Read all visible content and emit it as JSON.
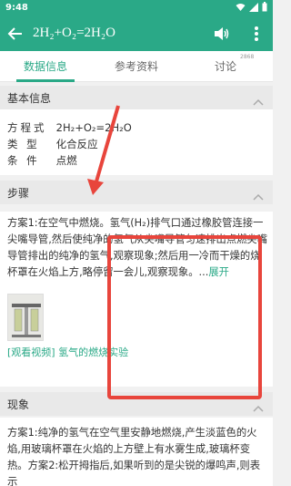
{
  "status_bar": {
    "time": "9:48"
  },
  "header": {
    "title": "2H₂+O₂=2H₂O"
  },
  "tabs": [
    {
      "label": "数据信息"
    },
    {
      "label": "参考资料"
    },
    {
      "label": "讨论",
      "badge": "2868"
    }
  ],
  "basic_info": {
    "heading": "基本信息",
    "rows": [
      {
        "label": "方程式",
        "value": "2H₂+O₂=2H₂O"
      },
      {
        "label": "类 型",
        "value": "化合反应"
      },
      {
        "label": "条 件",
        "value": "点燃"
      }
    ]
  },
  "steps": {
    "heading": "步骤",
    "text": "方案1:在空气中燃烧。氢气(H₂)排气口通过橡胶管连接一尖嘴导管,然后使纯净的氢气从尖嘴导管匀速排出点燃尖嘴导管排出的纯净的氢气,观察现象;然后用一冷而干燥的烧杯罩在火焰上方,略停留一会儿,观察现象。...",
    "expand_label": "展开",
    "video_link_prefix": "[观看视频]",
    "video_link_title": "氢气的燃烧实验"
  },
  "phenomena": {
    "heading": "现象",
    "text": "方案1:纯净的氢气在空气里安静地燃烧,产生淡蓝色的火焰,用玻璃杯罩在火焰的上方壁上有水雾生成,玻璃杯变热。方案2:松开拇指后,如果听到的是尖锐的爆鸣声,则表示"
  },
  "colors": {
    "accent": "#2aa987",
    "annotation": "#e8453c"
  },
  "icons": [
    "back-arrow-icon",
    "sound-icon",
    "more-vert-icon",
    "chevron-up-icon"
  ]
}
